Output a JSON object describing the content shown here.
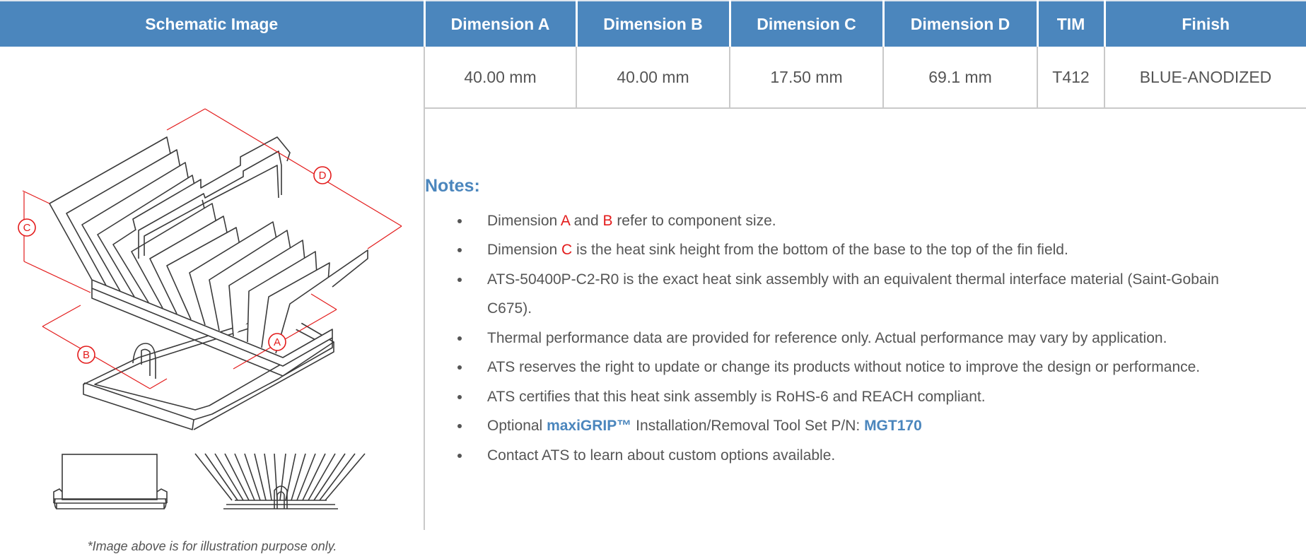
{
  "headers": {
    "schematic": "Schematic Image",
    "dim_a": "Dimension A",
    "dim_b": "Dimension B",
    "dim_c": "Dimension C",
    "dim_d": "Dimension D",
    "tim": "TIM",
    "finish": "Finish"
  },
  "values": {
    "dim_a": "40.00 mm",
    "dim_b": "40.00 mm",
    "dim_c": "17.50 mm",
    "dim_d": "69.1 mm",
    "tim": "T412",
    "finish": "BLUE-ANODIZED"
  },
  "schematic": {
    "callouts": {
      "a": "A",
      "b": "B",
      "c": "C",
      "d": "D"
    },
    "caption": "*Image above is for illustration purpose only.",
    "accent_color": "#e31b1b"
  },
  "notes": {
    "title": "Notes:",
    "n1": {
      "pre": "Dimension ",
      "a": "A",
      "mid": " and ",
      "b": "B",
      "post": " refer to component size."
    },
    "n2": {
      "pre": "Dimension ",
      "c": "C",
      "post": " is the heat sink height from the bottom of the base to the top of the fin field."
    },
    "n3": "ATS-50400P-C2-R0 is the exact heat sink assembly with an equivalent thermal interface material (Saint-Gobain C675).",
    "n4": "Thermal performance data are provided for reference only. Actual performance may vary by application.",
    "n5": "ATS reserves the right to update or change its products without notice to improve the design or performance.",
    "n6": "ATS certifies that this heat sink assembly is RoHS-6 and REACH compliant.",
    "n7": {
      "pre": "Optional ",
      "brand": "maxiGRIP™",
      "mid": " Installation/Removal Tool Set P/N: ",
      "part": "MGT170"
    },
    "n8": "Contact ATS to learn about custom options available."
  },
  "colors": {
    "header_bg": "#4b86bd",
    "header_text": "#ffffff",
    "body_text": "#555555",
    "highlight_red": "#e31b1b",
    "link_blue": "#4b86bd",
    "grid": "#c9c9c9"
  }
}
